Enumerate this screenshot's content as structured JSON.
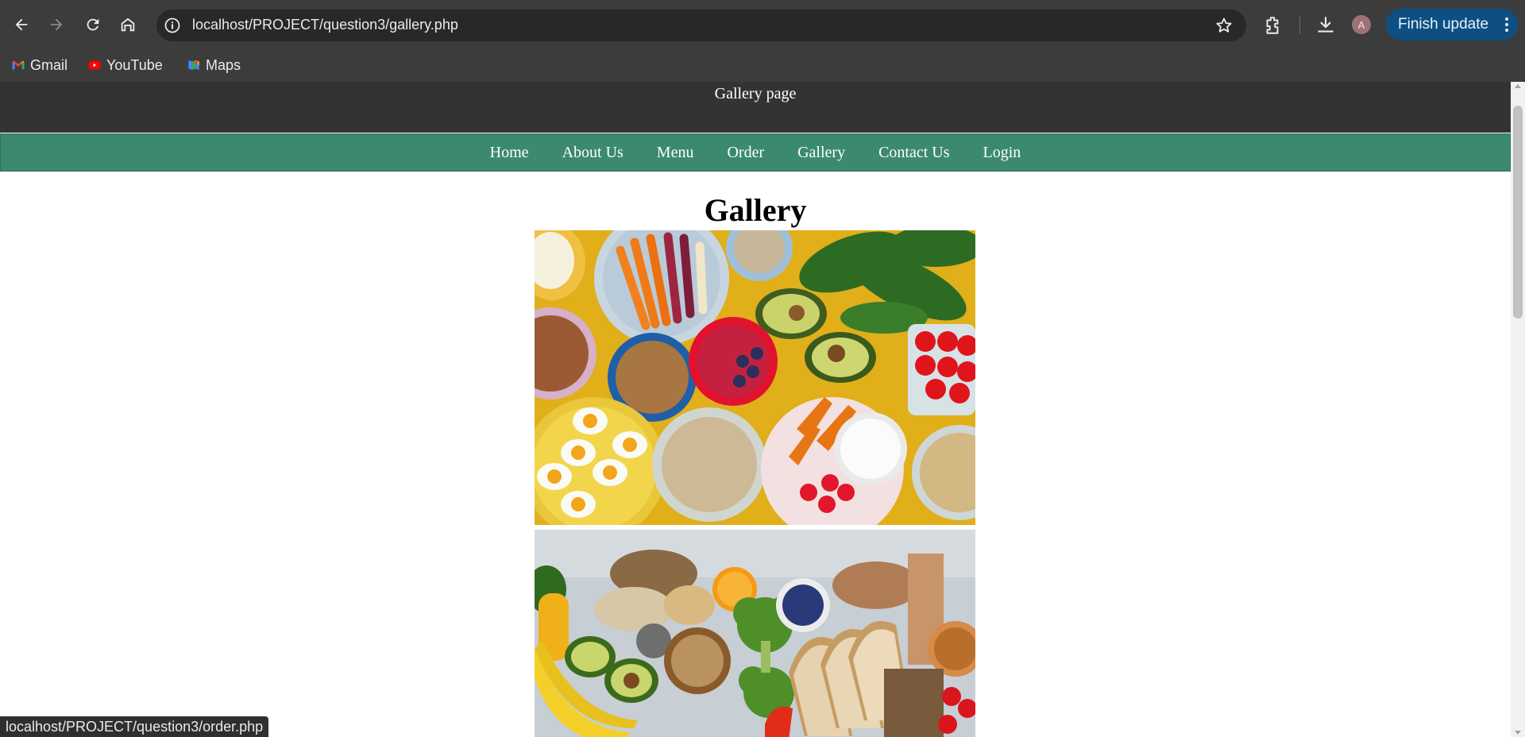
{
  "browser": {
    "url": "localhost/PROJECT/question3/gallery.php",
    "finish_update_label": "Finish update",
    "avatar_letter": "A",
    "bookmarks": [
      {
        "label": "Gmail",
        "icon": "gmail-icon"
      },
      {
        "label": "YouTube",
        "icon": "youtube-icon"
      },
      {
        "label": "Maps",
        "icon": "maps-icon"
      }
    ],
    "status_url": "localhost/PROJECT/question3/order.php"
  },
  "site": {
    "header_title": "Gallery page",
    "nav": [
      "Home",
      "About Us",
      "Menu",
      "Order",
      "Gallery",
      "Contact Us",
      "Login"
    ],
    "page_title": "Gallery"
  },
  "colors": {
    "header_bg": "#333333",
    "nav_bg": "#3c8a6e",
    "browser_chrome": "#3c3c3c",
    "update_button": "#0d4f82"
  }
}
